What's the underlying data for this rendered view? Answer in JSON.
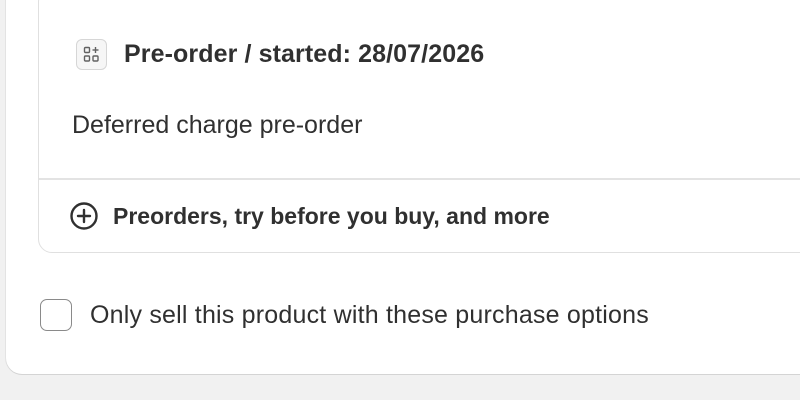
{
  "plan": {
    "title": "Pre-order / started: 28/07/2026",
    "description": "Deferred charge pre-order",
    "icon": "selling-plan-icon"
  },
  "add_option": {
    "label": "Preorders, try before you buy, and more",
    "icon": "plus-circle-icon"
  },
  "exclusive_option": {
    "label": "Only sell this product with these purchase options",
    "checked": false
  }
}
